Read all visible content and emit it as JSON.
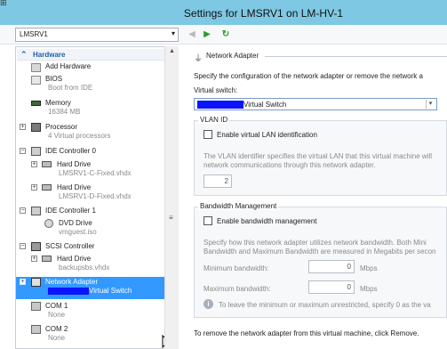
{
  "window": {
    "title": "Settings for LMSRV1 on LM-HV-1"
  },
  "vm_selector": {
    "value": "LMSRV1"
  },
  "sidebar": {
    "header": "Hardware",
    "items": [
      {
        "label": "Add Hardware",
        "sub": ""
      },
      {
        "label": "BIOS",
        "sub": "Boot from IDE"
      },
      {
        "label": "Memory",
        "sub": "16384 MB"
      },
      {
        "label": "Processor",
        "sub": "4 Virtual processors"
      },
      {
        "label": "IDE Controller 0",
        "sub": ""
      },
      {
        "label": "Hard Drive",
        "sub": "LMSRV1-C-Fixed.vhdx"
      },
      {
        "label": "Hard Drive",
        "sub": "LMSRV1-D-Fixed.vhdx"
      },
      {
        "label": "IDE Controller 1",
        "sub": ""
      },
      {
        "label": "DVD Drive",
        "sub": "vmguest.iso"
      },
      {
        "label": "SCSI Controller",
        "sub": ""
      },
      {
        "label": "Hard Drive",
        "sub": "backupsbs.vhdx"
      },
      {
        "label": "Network Adapter",
        "sub": "Virtual Switch"
      },
      {
        "label": "COM 1",
        "sub": "None"
      },
      {
        "label": "COM 2",
        "sub": "None"
      }
    ]
  },
  "main": {
    "section_title": "Network Adapter",
    "intro": "Specify the configuration of the network adapter or remove the network a",
    "vswitch_label": "Virtual switch:",
    "vswitch_value": "Virtual Switch",
    "vlan": {
      "title": "VLAN ID",
      "checkbox": "Enable virtual LAN identification",
      "desc1": "The VLAN identifier specifies the virtual LAN that this virtual machine will",
      "desc2": "network communications through this network adapter.",
      "value": "2"
    },
    "bandwidth": {
      "title": "Bandwidth Management",
      "checkbox": "Enable bandwidth management",
      "desc1": "Specify how this network adapter utilizes network bandwidth. Both Mini",
      "desc2": "Bandwidth and Maximum Bandwidth are measured in Megabits per secon",
      "min_label": "Minimum bandwidth:",
      "min_value": "0",
      "max_label": "Maximum bandwidth:",
      "max_value": "0",
      "unit": "Mbps",
      "note": "To leave the minimum or maximum unrestricted, specify 0 as the va"
    },
    "remove_text": "To remove the network adapter from this virtual machine, click Remove."
  },
  "colors": {
    "selection": "#3399ff",
    "titlebar": "#7ec8e3",
    "redaction": "#0a14ff"
  }
}
